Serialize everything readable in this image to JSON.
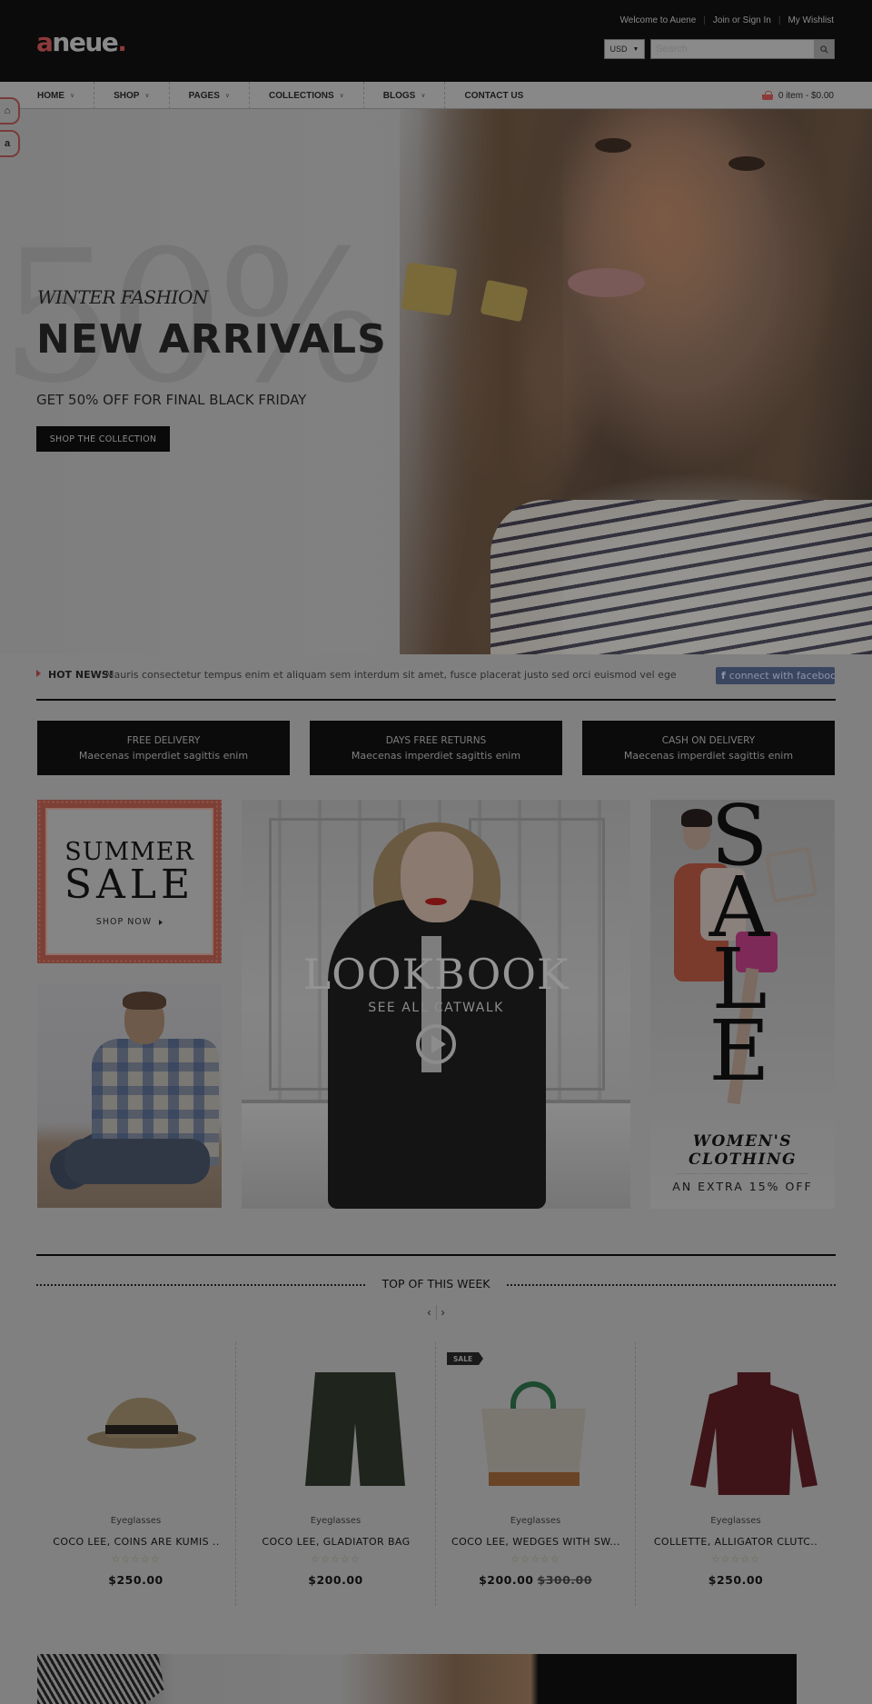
{
  "header": {
    "logo": {
      "first": "a",
      "rest": "neue",
      "dot": "."
    },
    "top_links": [
      "Welcome to Auene",
      "Join or Sign In",
      "My Wishlist"
    ],
    "currency": "USD",
    "search_placeholder": "Search",
    "search_icon": "search-icon"
  },
  "nav": {
    "items": [
      {
        "label": "HOME",
        "has_dropdown": true
      },
      {
        "label": "SHOP",
        "has_dropdown": true
      },
      {
        "label": "PAGES",
        "has_dropdown": true
      },
      {
        "label": "COLLECTIONS",
        "has_dropdown": true
      },
      {
        "label": "BLOGS",
        "has_dropdown": true
      },
      {
        "label": "CONTACT US",
        "has_dropdown": false
      }
    ],
    "cart": {
      "icon": "basket-icon",
      "label": "0 item - $0.00"
    }
  },
  "side_buttons": [
    {
      "icon": "home-icon",
      "glyph": "⌂"
    },
    {
      "icon": "letter-a-icon",
      "glyph": "a"
    }
  ],
  "hero": {
    "background_text": "50%",
    "kicker": "WINTER FASHION",
    "title": "NEW ARRIVALS",
    "subtitle": "GET 50% OFF FOR FINAL BLACK FRIDAY",
    "button": "SHOP THE COLLECTION"
  },
  "news": {
    "label": "HOT NEWS!",
    "text": "Mauris consectetur tempus enim et aliquam sem interdum sit amet, fusce placerat justo sed orci euismod vel egestas sapien",
    "facebook_button": "connect with facebook"
  },
  "features": [
    {
      "title": "FREE DELIVERY",
      "desc": "Maecenas imperdiet sagittis enim"
    },
    {
      "title": "DAYS FREE RETURNS",
      "desc": "Maecenas imperdiet sagittis enim"
    },
    {
      "title": "CASH ON DELIVERY",
      "desc": "Maecenas imperdiet sagittis enim"
    }
  ],
  "banners": {
    "summer": {
      "line1": "SUMMER",
      "line2": "SALE",
      "cta": "SHOP NOW"
    },
    "lookbook": {
      "title": "LOOKBOOK",
      "subtitle": "SEE ALL CATWALK"
    },
    "sale": {
      "letters": [
        "S",
        "A",
        "L",
        "E"
      ],
      "line1": "WOMEN'S",
      "line2": "CLOTHING",
      "line3": "AN EXTRA 15% OFF"
    }
  },
  "top_week": {
    "title": "TOP OF THIS WEEK",
    "prev": "‹",
    "next": "›",
    "products": [
      {
        "category": "Eyeglasses",
        "name": "COCO LEE, COINS ARE KUMIS ..",
        "rating": 0,
        "rating_max": 5,
        "stars": "☆☆☆☆☆",
        "price": "$250.00",
        "old_price": null,
        "sale": false
      },
      {
        "category": "Eyeglasses",
        "name": "COCO LEE, GLADIATOR BAG",
        "rating": 0,
        "rating_max": 5,
        "stars": "☆☆☆☆☆",
        "price": "$200.00",
        "old_price": null,
        "sale": false
      },
      {
        "category": "Eyeglasses",
        "name": "COCO LEE, WEDGES WITH SW...",
        "rating": 0,
        "rating_max": 5,
        "stars": "☆☆☆☆☆",
        "price": "$200.00",
        "old_price": "$300.00",
        "sale": true,
        "sale_label": "SALE"
      },
      {
        "category": "Eyeglasses",
        "name": "COLLETTE, ALLIGATOR CLUTC..",
        "rating": 0,
        "rating_max": 5,
        "stars": "☆☆☆☆☆",
        "price": "$250.00",
        "old_price": null,
        "sale": false
      }
    ]
  },
  "colors": {
    "accent": "#8c3a3a",
    "header_bg": "#0b0b0b",
    "page_overlay_bg": "#808080",
    "facebook": "#3a4660"
  }
}
